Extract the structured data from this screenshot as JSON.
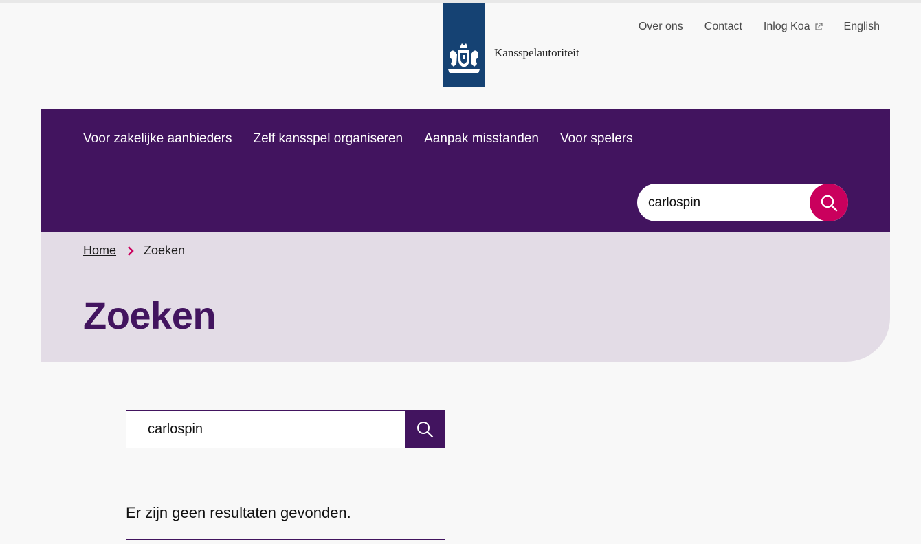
{
  "logo": {
    "org_name": "Kansspelautoriteit",
    "emblem_icon": "rijksoverheid-emblem-icon",
    "color": "#154273"
  },
  "utility_nav": {
    "items": [
      {
        "label": "Over ons"
      },
      {
        "label": "Contact"
      },
      {
        "label": "Inlog Koa",
        "icon": "external-link-icon"
      },
      {
        "label": "English"
      }
    ]
  },
  "main_nav": {
    "items": [
      {
        "label": "Voor zakelijke aanbieders"
      },
      {
        "label": "Zelf kansspel organiseren"
      },
      {
        "label": "Aanpak misstanden"
      },
      {
        "label": "Voor spelers"
      }
    ]
  },
  "header_search": {
    "value": "carlospin",
    "button_icon": "search-icon",
    "button_color": "#ca005d"
  },
  "breadcrumb": {
    "home": "Home",
    "separator_icon": "chevron-right-icon",
    "current": "Zoeken"
  },
  "page": {
    "title": "Zoeken"
  },
  "search_form": {
    "value": "carlospin",
    "button_icon": "search-icon"
  },
  "results": {
    "message": "Er zijn geen resultaten gevonden."
  },
  "colors": {
    "primary": "#42145f",
    "accent": "#ca005d",
    "hero_bg": "#e3dce6"
  }
}
